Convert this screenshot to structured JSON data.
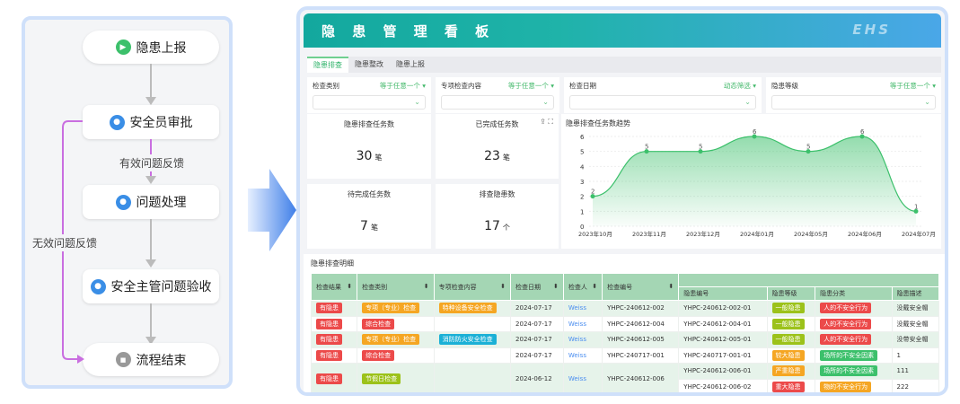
{
  "flow": {
    "nodes": [
      "隐患上报",
      "安全员审批",
      "问题处理",
      "安全主管问题验收",
      "流程结束"
    ],
    "valid_feedback": "有效问题反馈",
    "invalid_feedback": "无效问题反馈"
  },
  "header": {
    "title": "隐 患 管 理 看 板",
    "logo": "EHS"
  },
  "tabs": [
    "隐患排查",
    "隐患整改",
    "隐患上报"
  ],
  "filters": [
    {
      "label": "检查类别",
      "op": "等于任意一个"
    },
    {
      "label": "专项检查内容",
      "op": "等于任意一个"
    },
    {
      "label": "检查日期",
      "op": "动态筛选"
    },
    {
      "label": "隐患等级",
      "op": "等于任意一个"
    }
  ],
  "cards": [
    {
      "title": "隐患排查任务数",
      "value": "30",
      "unit": "笔"
    },
    {
      "title": "已完成任务数",
      "value": "23",
      "unit": "笔"
    },
    {
      "title": "待完成任务数",
      "value": "7",
      "unit": "笔"
    },
    {
      "title": "排查隐患数",
      "value": "17",
      "unit": "个"
    }
  ],
  "chart_data": {
    "type": "area",
    "title": "隐患排查任务数趋势",
    "categories": [
      "2023年10月",
      "2023年11月",
      "2023年12月",
      "2024年01月",
      "2024年05月",
      "2024年06月",
      "2024年07月"
    ],
    "values": [
      2,
      5,
      5,
      6,
      5,
      6,
      1
    ],
    "ylim": [
      0,
      6
    ],
    "yticks": [
      0,
      1,
      2,
      3,
      4,
      5,
      6
    ],
    "color": "#3cc06b"
  },
  "table": {
    "title": "隐患排查明细",
    "headers": [
      "检查结果",
      "检查类别",
      "专项检查内容",
      "检查日期",
      "检查人",
      "检查编号",
      "隐患编号",
      "隐患等级",
      "隐患分类",
      "隐患描述"
    ],
    "rows": [
      {
        "result": "有隐患",
        "cat": "专项（专业）检查",
        "cat_color": "#f5a623",
        "special": "特种设备安全检查",
        "special_color": "#f5a623",
        "date": "2024-07-17",
        "inspector": "Weiss",
        "no": "YHPC-240612-002",
        "hid": "YHPC-240612-002-01",
        "level": "一般隐患",
        "level_color": "#9cc21a",
        "class": "人的不安全行为",
        "class_color": "#ec4a4a",
        "desc": "没戴安全帽"
      },
      {
        "result": "有隐患",
        "cat": "综合检查",
        "cat_color": "#ec4a4a",
        "special": "",
        "date": "2024-07-17",
        "inspector": "Weiss",
        "no": "YHPC-240612-004",
        "hid": "YHPC-240612-004-01",
        "level": "一般隐患",
        "level_color": "#9cc21a",
        "class": "人的不安全行为",
        "class_color": "#ec4a4a",
        "desc": "没戴安全帽"
      },
      {
        "result": "有隐患",
        "cat": "专项（专业）检查",
        "cat_color": "#f5a623",
        "special": "消防防火安全检查",
        "special_color": "#1bb0d6",
        "date": "2024-07-17",
        "inspector": "Weiss",
        "no": "YHPC-240612-005",
        "hid": "YHPC-240612-005-01",
        "level": "一般隐患",
        "level_color": "#9cc21a",
        "class": "人的不安全行为",
        "class_color": "#ec4a4a",
        "desc": "没带安全帽"
      },
      {
        "result": "有隐患",
        "cat": "综合检查",
        "cat_color": "#ec4a4a",
        "special": "",
        "date": "2024-07-17",
        "inspector": "Weiss",
        "no": "YHPC-240717-001",
        "hid": "YHPC-240717-001-01",
        "level": "较大隐患",
        "level_color": "#f5a623",
        "class": "场所的不安全因素",
        "class_color": "#3cc06b",
        "desc": "1"
      },
      {
        "result": "有隐患",
        "cat": "节假日检查",
        "cat_color": "#9cc21a",
        "special": "",
        "date": "2024-06-12",
        "inspector": "Weiss",
        "no": "YHPC-240612-006",
        "hid": "YHPC-240612-006-01",
        "level": "严重隐患",
        "level_color": "#f5a623",
        "class": "场所的不安全因素",
        "class_color": "#3cc06b",
        "desc": "111"
      },
      {
        "hid": "YHPC-240612-006-02",
        "level": "重大隐患",
        "level_color": "#ec4a4a",
        "class": "物的不安全行为",
        "class_color": "#f5a623",
        "desc": "222"
      }
    ]
  }
}
